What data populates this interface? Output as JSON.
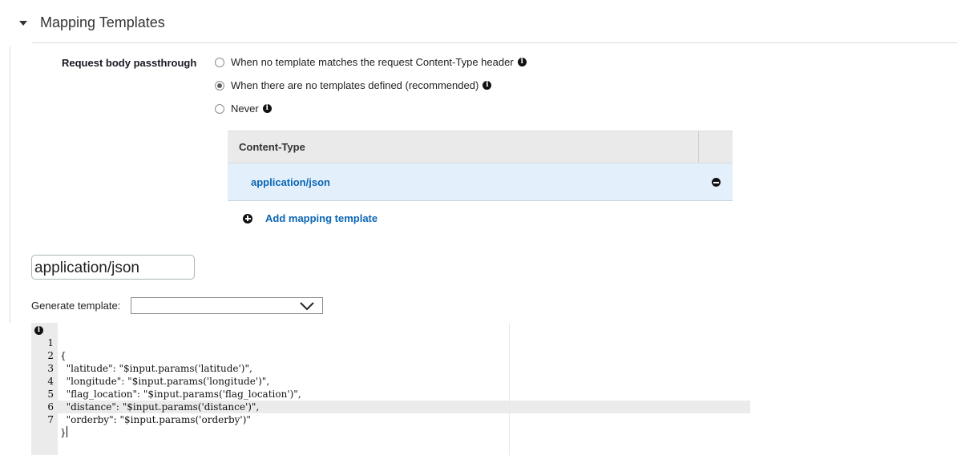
{
  "section": {
    "title": "Mapping Templates"
  },
  "passthrough": {
    "label": "Request body passthrough",
    "options": [
      {
        "label": "When no template matches the request Content-Type header",
        "selected": false,
        "info": true
      },
      {
        "label": "When there are no templates defined (recommended)",
        "selected": true,
        "info": true
      },
      {
        "label": "Never",
        "selected": false,
        "info": true
      }
    ]
  },
  "content_type_table": {
    "header": "Content-Type",
    "rows": [
      {
        "value": "application/json"
      }
    ],
    "add_label": "Add mapping template"
  },
  "content_type_input": {
    "value": "application/json"
  },
  "generate_template": {
    "label": "Generate template:",
    "selected": ""
  },
  "editor": {
    "lines": [
      {
        "no": "1",
        "text": "{"
      },
      {
        "no": "2",
        "text": "  \"latitude\": \"$input.params('latitude')\","
      },
      {
        "no": "3",
        "text": "  \"longitude\": \"$input.params('longitude')\","
      },
      {
        "no": "4",
        "text": "  \"flag_location\": \"$input.params('flag_location')\","
      },
      {
        "no": "5",
        "text": "  \"distance\": \"$input.params('distance')\","
      },
      {
        "no": "6",
        "text": "  \"orderby\": \"$input.params('orderby')\""
      },
      {
        "no": "7",
        "text": "}"
      }
    ]
  },
  "icons": {
    "caret": "caret-down-icon",
    "info": "info-icon",
    "remove": "remove-icon",
    "add": "add-icon",
    "select": "chevron-down-icon"
  },
  "colors": {
    "link": "#0b67b5",
    "selected_row": "#e3f0fb",
    "table_header": "#eaeaea"
  }
}
